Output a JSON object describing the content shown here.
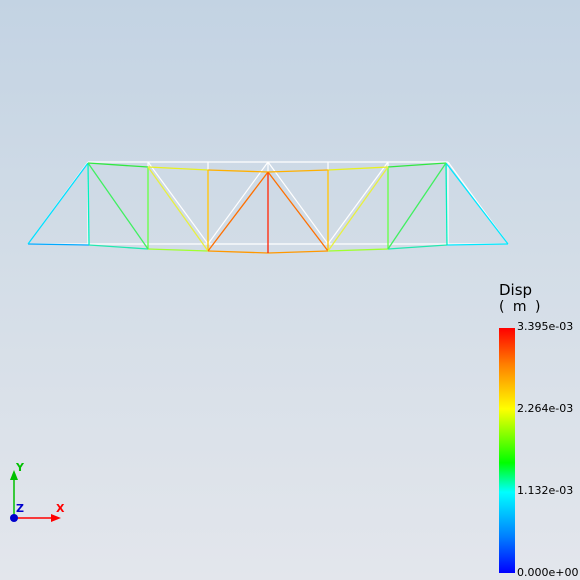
{
  "legend": {
    "title": "Disp",
    "unit": "( m )",
    "ticks": [
      "3.395e-03",
      "2.264e-03",
      "1.132e-03",
      "0.000e+00"
    ]
  },
  "triad": {
    "x_label": "X",
    "y_label": "Y",
    "z_label": "Z"
  },
  "colors": {
    "x_axis": "#ff0000",
    "y_axis": "#00c000",
    "z_axis": "#0000ff",
    "scale_max": "#ff0000",
    "scale_min": "#0000ff"
  }
}
